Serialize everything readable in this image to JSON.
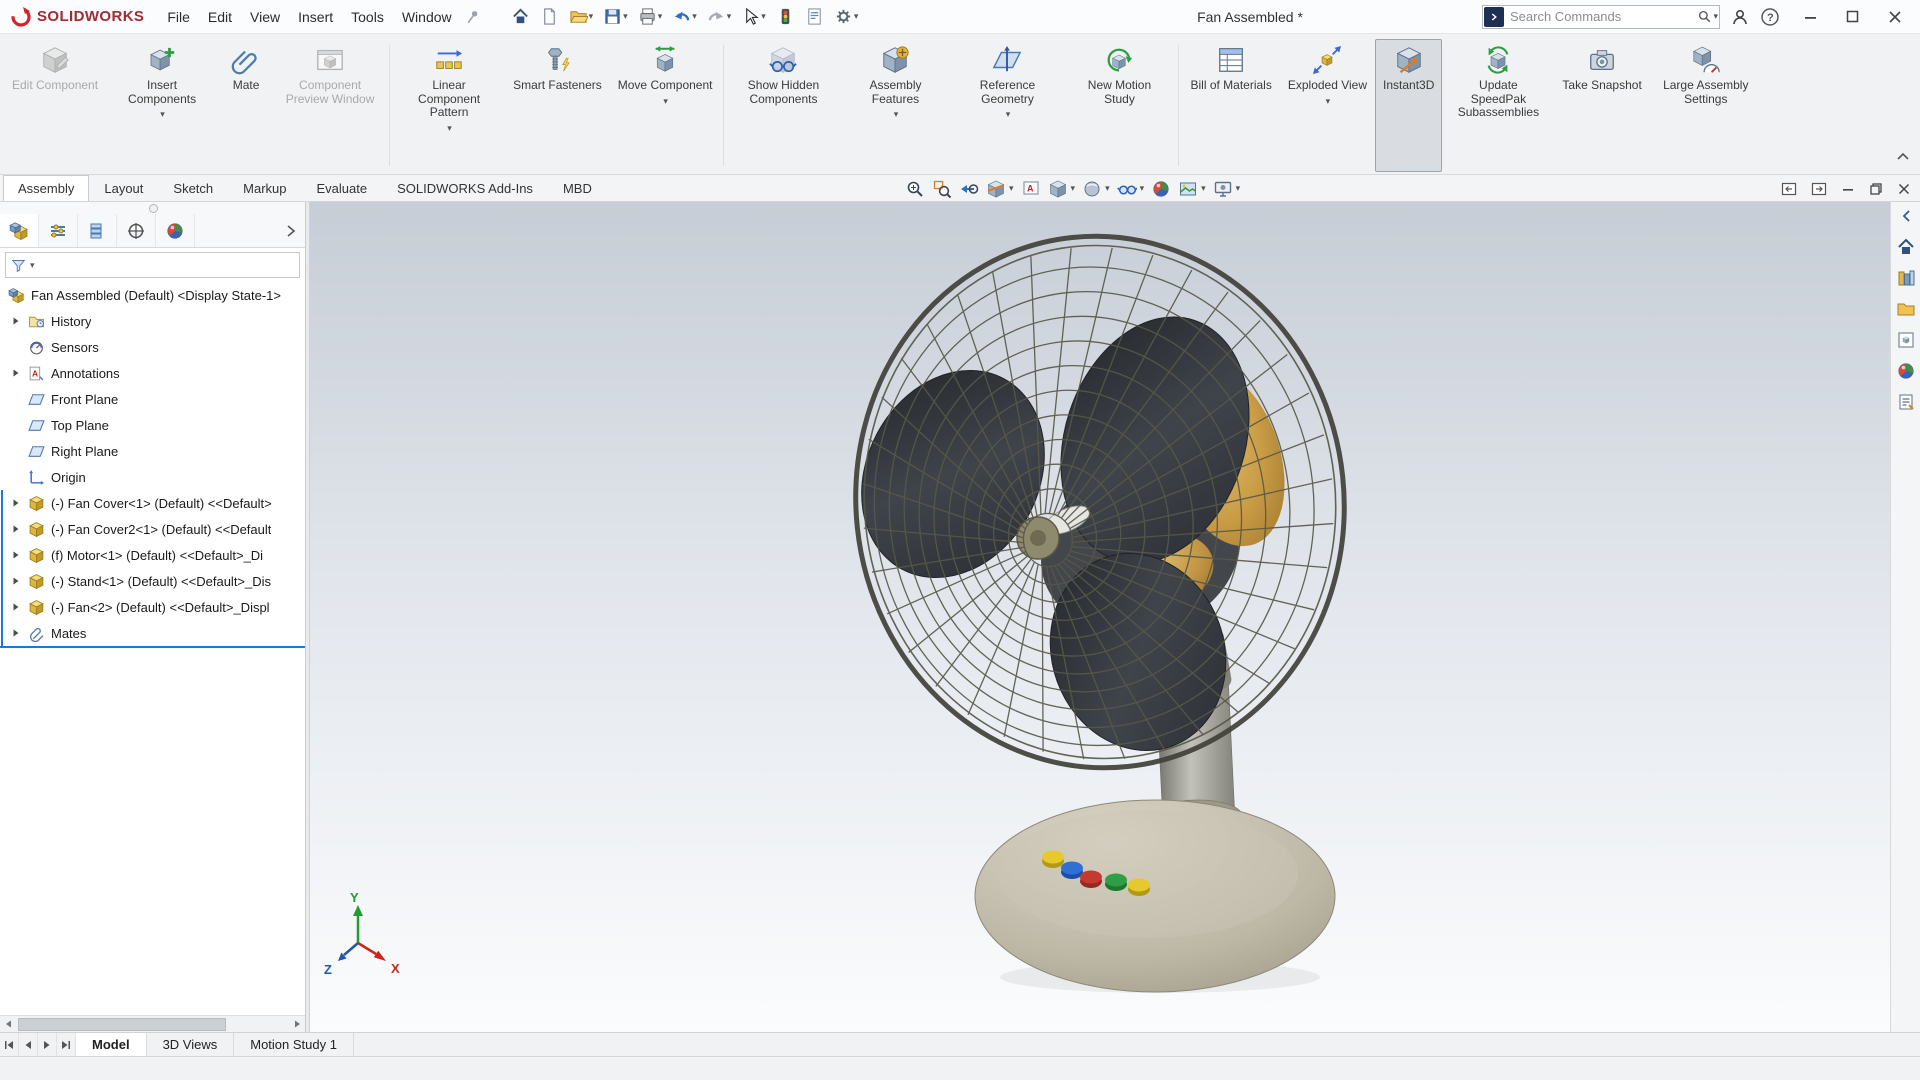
{
  "titlebar": {
    "brand": "SOLIDWORKS",
    "menus": [
      "File",
      "Edit",
      "View",
      "Insert",
      "Tools",
      "Window"
    ],
    "document_title": "Fan Assembled *",
    "search": {
      "placeholder": "Search Commands"
    }
  },
  "ribbon": {
    "buttons": [
      {
        "label": "Edit Component",
        "state": "disabled",
        "dropdown": false
      },
      {
        "label": "Insert Components",
        "state": "normal",
        "dropdown": true
      },
      {
        "label": "Mate",
        "state": "normal",
        "dropdown": false
      },
      {
        "label": "Component Preview Window",
        "state": "disabled",
        "dropdown": false
      },
      {
        "label": "Linear Component Pattern",
        "state": "normal",
        "dropdown": true
      },
      {
        "label": "Smart Fasteners",
        "state": "normal",
        "dropdown": false
      },
      {
        "label": "Move Component",
        "state": "normal",
        "dropdown": true
      },
      {
        "label": "Show Hidden Components",
        "state": "normal",
        "dropdown": false
      },
      {
        "label": "Assembly Features",
        "state": "normal",
        "dropdown": true
      },
      {
        "label": "Reference Geometry",
        "state": "normal",
        "dropdown": true
      },
      {
        "label": "New Motion Study",
        "state": "normal",
        "dropdown": false
      },
      {
        "label": "Bill of Materials",
        "state": "normal",
        "dropdown": false
      },
      {
        "label": "Exploded View",
        "state": "normal",
        "dropdown": true
      },
      {
        "label": "Instant3D",
        "state": "active",
        "dropdown": false
      },
      {
        "label": "Update SpeedPak Subassemblies",
        "state": "normal",
        "dropdown": false
      },
      {
        "label": "Take Snapshot",
        "state": "normal",
        "dropdown": false
      },
      {
        "label": "Large Assembly Settings",
        "state": "normal",
        "dropdown": false
      }
    ]
  },
  "command_tabs": {
    "active": "Assembly",
    "items": [
      "Assembly",
      "Layout",
      "Sketch",
      "Markup",
      "Evaluate",
      "SOLIDWORKS Add-Ins",
      "MBD"
    ]
  },
  "feature_tree": {
    "root": "Fan Assembled (Default) <Display State-1>",
    "items": [
      {
        "label": "History",
        "icon": "history-folder-icon",
        "expandable": true
      },
      {
        "label": "Sensors",
        "icon": "sensors-icon",
        "expandable": false
      },
      {
        "label": "Annotations",
        "icon": "annotations-icon",
        "expandable": true
      },
      {
        "label": "Front Plane",
        "icon": "plane-icon",
        "expandable": false
      },
      {
        "label": "Top Plane",
        "icon": "plane-icon",
        "expandable": false
      },
      {
        "label": "Right Plane",
        "icon": "plane-icon",
        "expandable": false
      },
      {
        "label": "Origin",
        "icon": "origin-icon",
        "expandable": false
      },
      {
        "label": "(-) Fan Cover<1> (Default) <<Default>",
        "icon": "part-icon",
        "expandable": true
      },
      {
        "label": "(-) Fan Cover2<1> (Default) <<Default",
        "icon": "part-icon",
        "expandable": true
      },
      {
        "label": "(f) Motor<1> (Default) <<Default>_Di",
        "icon": "part-icon",
        "expandable": true
      },
      {
        "label": "(-) Stand<1> (Default) <<Default>_Dis",
        "icon": "part-icon",
        "expandable": true
      },
      {
        "label": "(-) Fan<2> (Default) <<Default>_Displ",
        "icon": "part-icon",
        "expandable": true
      },
      {
        "label": "Mates",
        "icon": "mates-icon",
        "expandable": true
      }
    ]
  },
  "bottom_tabs": {
    "active": "Model",
    "items": [
      "Model",
      "3D Views",
      "Motion Study 1"
    ]
  },
  "viewport": {
    "triad": {
      "x": "X",
      "y": "Y",
      "z": "Z"
    }
  },
  "colors": {
    "accent_blue": "#1e78d7",
    "viewport_gradient_top": "#c7cdd6",
    "viewport_gradient_bottom": "#fbfcfd",
    "cage_wire": "#57584a",
    "blade": "#34373d",
    "motor_gold": "#c99c48",
    "base": "#b5ae9c",
    "button_colors": [
      "#e6c92c",
      "#2f6fd6",
      "#c43a2e",
      "#2f9e44",
      "#e6c92c"
    ]
  }
}
